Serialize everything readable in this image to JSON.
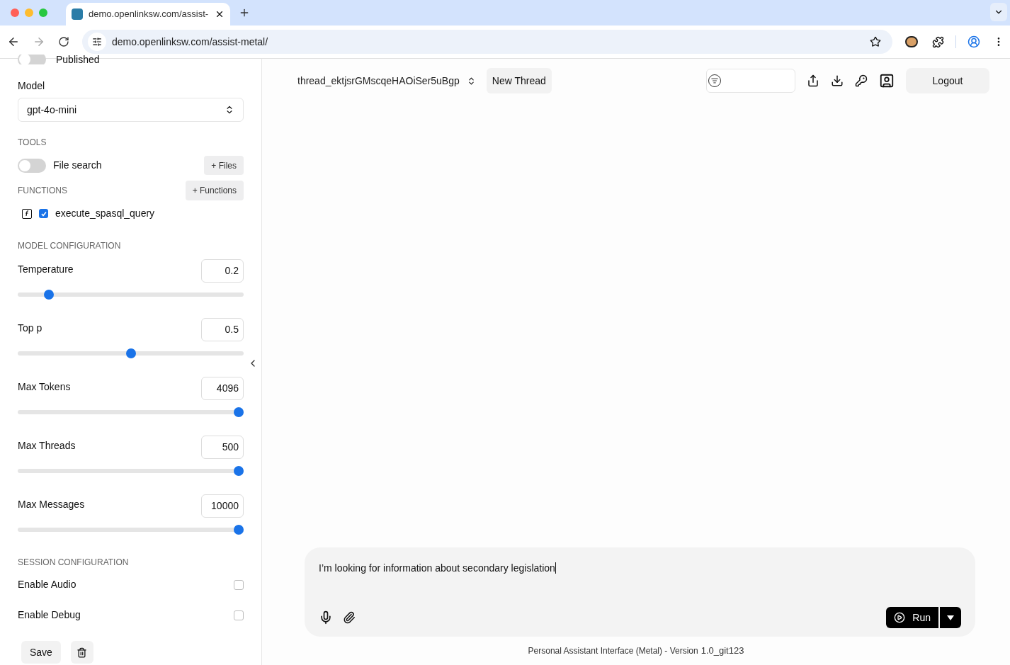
{
  "browser": {
    "tab_title": "demo.openlinksw.com/assist-",
    "url": "demo.openlinksw.com/assist-metal/"
  },
  "sidebar": {
    "published": {
      "label": "Published",
      "on": false
    },
    "model": {
      "label": "Model",
      "value": "gpt-4o-mini"
    },
    "tools": {
      "heading": "TOOLS",
      "file_search": {
        "label": "File search",
        "on": false
      },
      "files_button": "+ Files"
    },
    "functions": {
      "heading": "FUNCTIONS",
      "add_button": "+ Functions",
      "items": [
        {
          "name": "execute_spasql_query",
          "checked": true
        }
      ]
    },
    "model_config": {
      "heading": "MODEL CONFIGURATION",
      "params": [
        {
          "label": "Temperature",
          "value": "0.2",
          "level": 0.12
        },
        {
          "label": "Top p",
          "value": "0.5",
          "level": 0.5
        },
        {
          "label": "Max Tokens",
          "value": "4096",
          "level": 1
        },
        {
          "label": "Max Threads",
          "value": "500",
          "level": 1
        },
        {
          "label": "Max Messages",
          "value": "10000",
          "level": 1
        }
      ]
    },
    "session_config": {
      "heading": "SESSION CONFIGURATION",
      "options": [
        {
          "label": "Enable Audio",
          "checked": false
        },
        {
          "label": "Enable Debug",
          "checked": false
        }
      ]
    },
    "save_button": "Save"
  },
  "header": {
    "thread_id": "thread_ektjsrGMscqeHAOiSer5uBgp",
    "new_thread_button": "New Thread",
    "logout_button": "Logout"
  },
  "composer": {
    "value": "I’m looking for information about secondary legislation",
    "run_button": "Run"
  },
  "footer": {
    "text": "Personal Assistant Interface (Metal) - Version",
    "version": "1.0_git123"
  }
}
